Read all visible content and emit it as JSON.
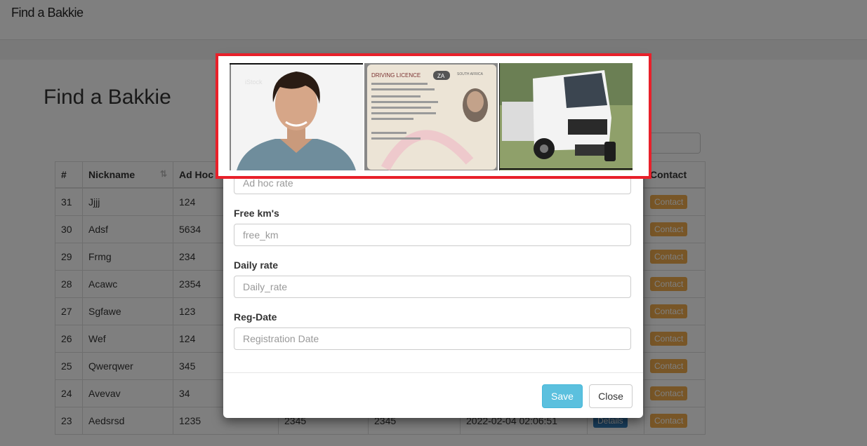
{
  "navbar": {
    "brand": "Find a Bakkie"
  },
  "page": {
    "title": "Find a Bakkie"
  },
  "table": {
    "headers": {
      "id": "#",
      "nickname": "Nickname",
      "adhoc": "Ad Hoc",
      "contact": "Contact"
    },
    "details_label": "Details",
    "contact_label": "Contact",
    "rows": [
      {
        "id": "31",
        "nickname": "Jjjj",
        "adhoc": "124"
      },
      {
        "id": "30",
        "nickname": "Adsf",
        "adhoc": "5634"
      },
      {
        "id": "29",
        "nickname": "Frmg",
        "adhoc": "234"
      },
      {
        "id": "28",
        "nickname": "Acawc",
        "adhoc": "2354"
      },
      {
        "id": "27",
        "nickname": "Sgfawe",
        "adhoc": "123"
      },
      {
        "id": "26",
        "nickname": "Wef",
        "adhoc": "124"
      },
      {
        "id": "25",
        "nickname": "Qwerqwer",
        "adhoc": "345"
      },
      {
        "id": "24",
        "nickname": "Avevav",
        "adhoc": "34"
      },
      {
        "id": "23",
        "nickname": "Aedsrsd",
        "adhoc": "1235",
        "c4": "2345",
        "c5": "2345",
        "date": "2022-02-04 02:06:51"
      }
    ]
  },
  "modal": {
    "images": {
      "portrait": "iStock",
      "license_header": "DRIVING LICENCE",
      "license_badge": "ZA",
      "license_country": "SOUTH AFRICA"
    },
    "adhoc_placeholder": "Ad hoc rate",
    "free_km_label": "Free km's",
    "free_km_placeholder": "free_km",
    "daily_rate_label": "Daily rate",
    "daily_rate_placeholder": "Daily_rate",
    "reg_date_label": "Reg-Date",
    "reg_date_placeholder": "Registration Date",
    "save_label": "Save",
    "close_label": "Close"
  },
  "colors": {
    "highlight": "#e8202a",
    "save": "#5bc0de",
    "details": "#337ab7",
    "contact": "#f0ad4e"
  }
}
